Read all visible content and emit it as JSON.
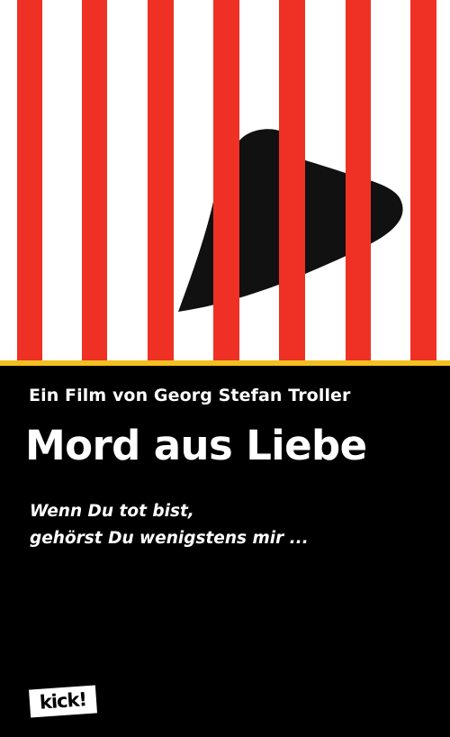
{
  "colors": {
    "stripe": "#ee3124",
    "background_top": "#ffffff",
    "heart": "#111111",
    "divider": "#f3c021",
    "background_bottom": "#000000",
    "text": "#ffffff"
  },
  "artwork": {
    "motif": "heart-behind-bars-icon"
  },
  "credit": "Ein Film von Georg Stefan Troller",
  "title": "Mord aus Liebe",
  "tagline": {
    "line1": "Wenn Du tot bist,",
    "line2": "gehörst Du wenigstens mir ..."
  },
  "logo": {
    "text": "kick!"
  }
}
